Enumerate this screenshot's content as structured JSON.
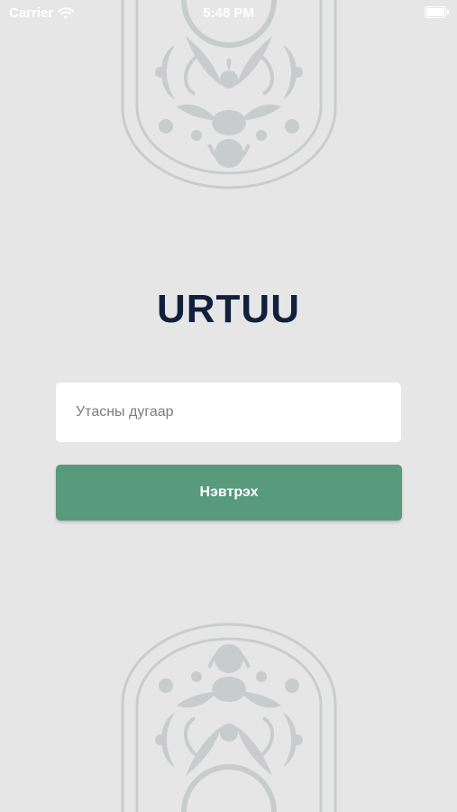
{
  "status_bar": {
    "carrier": "Carrier",
    "time": "5:48 PM",
    "battery_level": 1.0
  },
  "brand": {
    "logo_text": "URTUU"
  },
  "login_form": {
    "phone_placeholder": "Утасны дугаар",
    "phone_value": "",
    "submit_label": "Нэвтрэх"
  },
  "colors": {
    "background": "#e6e6e6",
    "accent": "#579a7c",
    "logo": "#10213d",
    "ornament": "#c9cccd"
  },
  "icons": {
    "wifi": "wifi-icon",
    "battery": "battery-icon",
    "ornament": "mongolian-ornament"
  }
}
